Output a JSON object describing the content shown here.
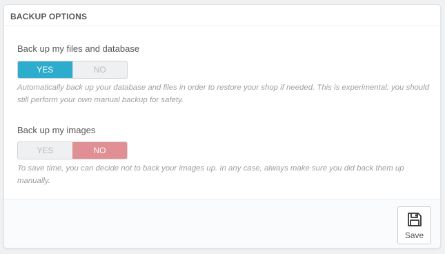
{
  "panel": {
    "title": "BACKUP OPTIONS"
  },
  "options": [
    {
      "label": "Back up my files and database",
      "yes_label": "YES",
      "no_label": "NO",
      "selected": "YES",
      "help": "Automatically back up your database and files in order to restore your shop if needed. This is experimental: you should still perform your own manual backup for safety."
    },
    {
      "label": "Back up my images",
      "yes_label": "YES",
      "no_label": "NO",
      "selected": "NO",
      "help": "To save time, you can decide not to back your images up. In any case, always make sure you did back them up manually."
    }
  ],
  "footer": {
    "save_label": "Save",
    "save_icon": "floppy-disk-icon"
  },
  "colors": {
    "yes_active": "#2eacce",
    "no_active": "#e08f95"
  }
}
